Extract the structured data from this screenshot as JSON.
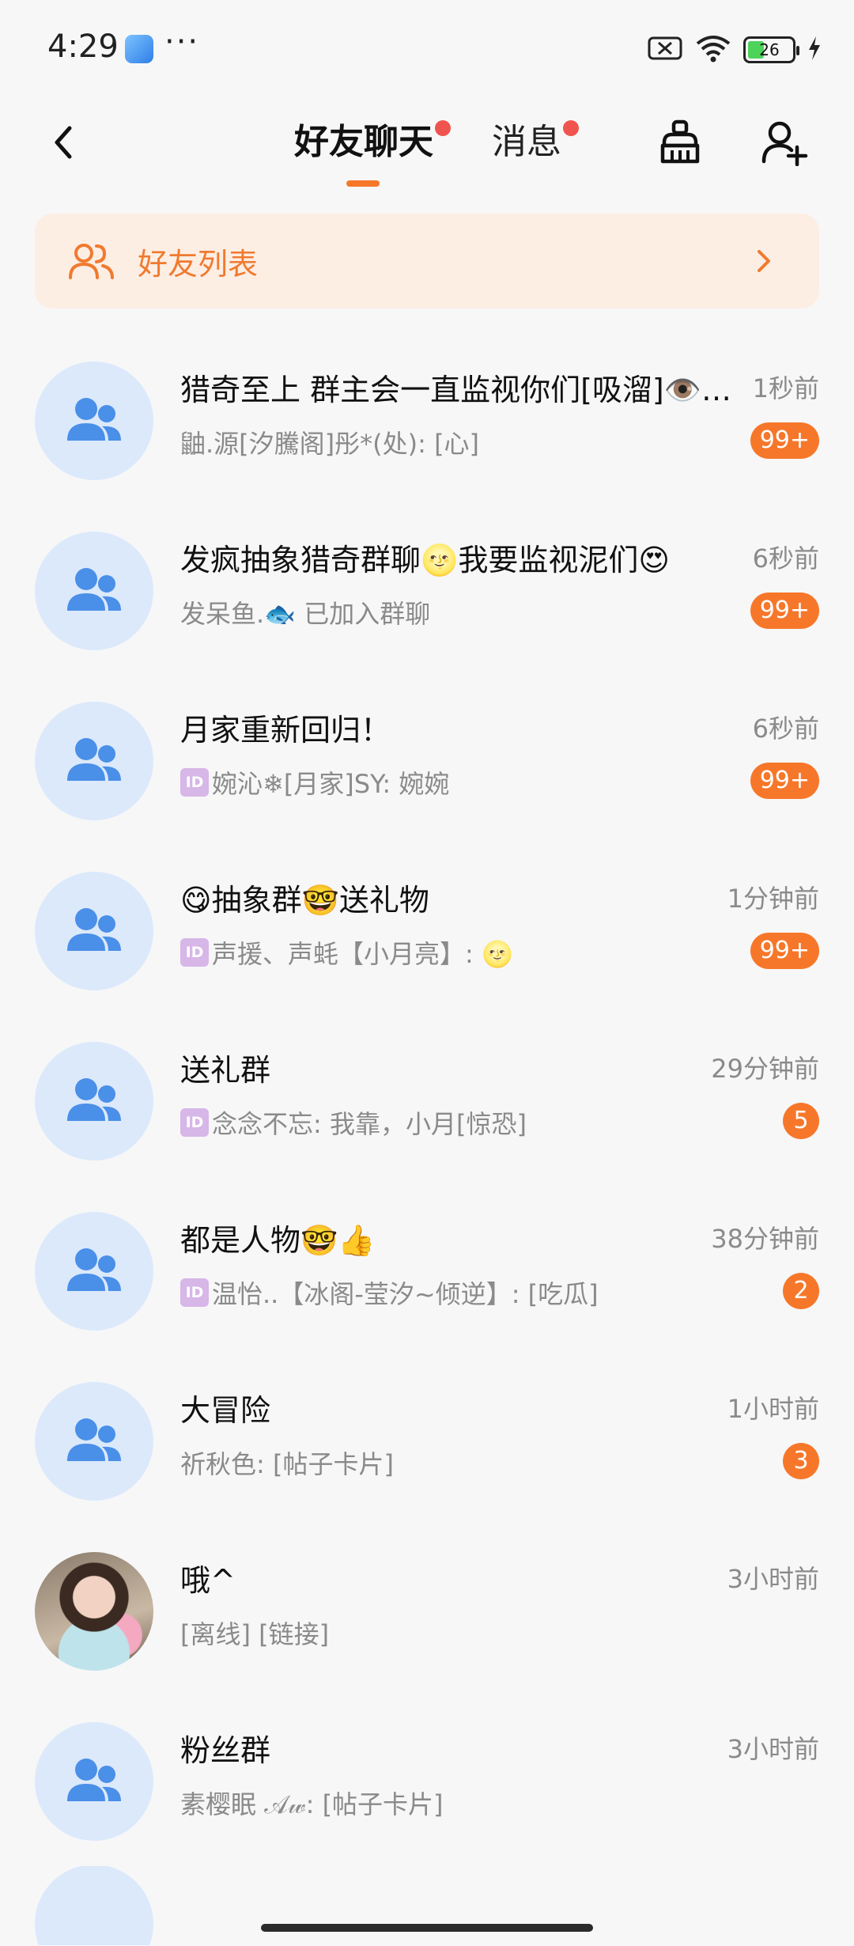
{
  "status_bar": {
    "time": "4:29",
    "dots": "···",
    "battery_level": "26",
    "icons": [
      "app-icon",
      "sim-off-icon",
      "wifi-icon",
      "battery-icon",
      "charging-icon"
    ]
  },
  "header": {
    "tabs": [
      {
        "label": "好友聊天",
        "active": true,
        "has_dot": true
      },
      {
        "label": "消息",
        "active": false,
        "has_dot": true
      }
    ],
    "icons": [
      "back-icon",
      "clean-icon",
      "add-friend-icon"
    ]
  },
  "banner": {
    "label": "好友列表",
    "icon": "friends-icon"
  },
  "chats": [
    {
      "name": "猎奇至上 群主会一直监视你们[吸溜]👁️…",
      "time": "1秒前",
      "id_tag": false,
      "preview": "鼬.源[汐騰阁]彤*(处): [心]",
      "badge": "99+"
    },
    {
      "name": "发疯抽象猎奇群聊🌝我要监视泥们😍",
      "time": "6秒前",
      "id_tag": false,
      "preview": "发呆鱼.🐟 已加入群聊",
      "badge": "99+"
    },
    {
      "name": "月家重新回归！",
      "time": "6秒前",
      "id_tag": true,
      "preview": "婉沁❄[月家]SY: 婉婉",
      "badge": "99+"
    },
    {
      "name": "😋抽象群🤓送礼物",
      "time": "1分钟前",
      "id_tag": true,
      "preview": "声援、声蚝【小月亮】: 🌝",
      "badge": "99+"
    },
    {
      "name": "送礼群",
      "time": "29分钟前",
      "id_tag": true,
      "preview": "念念不忘: 我靠，小月[惊恐]",
      "badge": "5"
    },
    {
      "name": "都是人物🤓👍",
      "time": "38分钟前",
      "id_tag": true,
      "preview": "温怡..【冰阁-莹汐~倾逆】: [吃瓜]",
      "badge": "2"
    },
    {
      "name": "大冒险",
      "time": "1小时前",
      "id_tag": false,
      "preview": "祈秋色: [帖子卡片]",
      "badge": "3"
    },
    {
      "name": "哦^",
      "time": "3小时前",
      "id_tag": false,
      "preview": "[离线] [链接]",
      "badge": ""
    },
    {
      "name": "粉丝群",
      "time": "3小时前",
      "id_tag": false,
      "preview": "素樱眠 𝒜𝓌: [帖子卡片]",
      "badge": ""
    }
  ],
  "colors": {
    "accent": "#f7772a",
    "badge": "#f7772a",
    "dot": "#f0544e",
    "avatar_bg": "#dbe9fb",
    "group_icon": "#4a8fe8",
    "banner_bg": "#fdeee4",
    "banner_text": "#f07a2f"
  }
}
